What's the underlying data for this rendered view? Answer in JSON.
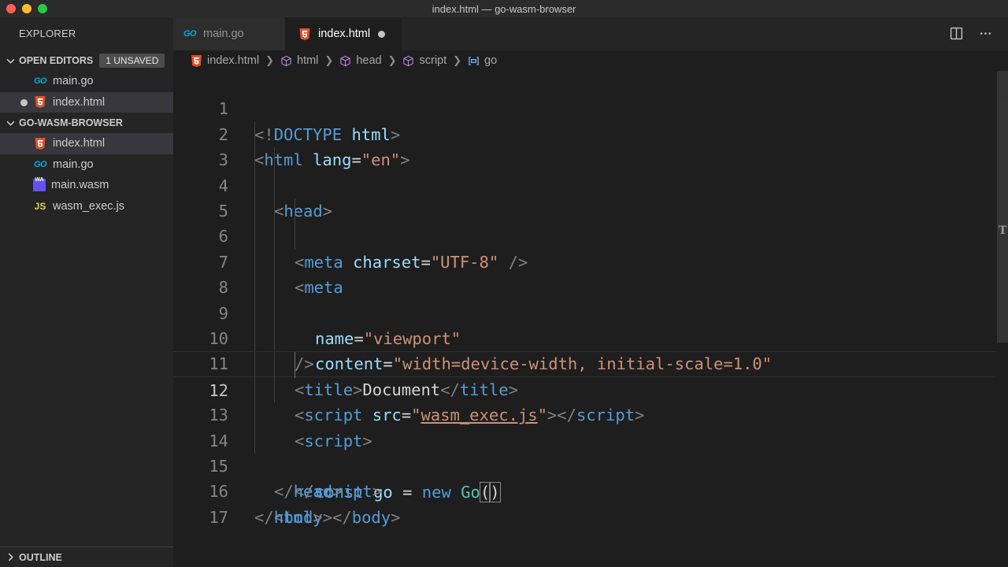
{
  "window": {
    "title": "index.html — go-wasm-browser"
  },
  "sidebar": {
    "title": "EXPLORER",
    "open_editors": {
      "label": "OPEN EDITORS",
      "badge": "1 UNSAVED",
      "items": [
        {
          "name": "main.go",
          "icon": "go-icon",
          "unsaved": false
        },
        {
          "name": "index.html",
          "icon": "html5-icon",
          "unsaved": true
        }
      ]
    },
    "project": {
      "label": "GO-WASM-BROWSER",
      "items": [
        {
          "name": "index.html",
          "icon": "html5-icon",
          "selected": true
        },
        {
          "name": "main.go",
          "icon": "go-icon"
        },
        {
          "name": "main.wasm",
          "icon": "wasm-icon"
        },
        {
          "name": "wasm_exec.js",
          "icon": "js-icon"
        }
      ]
    },
    "outline": {
      "label": "OUTLINE"
    }
  },
  "icons": {
    "go": "GO",
    "js": "JS",
    "wasm": "WA"
  },
  "tabs": [
    {
      "label": "main.go",
      "active": false
    },
    {
      "label": "index.html",
      "active": true,
      "unsaved": true
    }
  ],
  "breadcrumb": [
    "index.html",
    "html",
    "head",
    "script",
    "go"
  ],
  "editor": {
    "line_numbers": [
      "1",
      "2",
      "3",
      "4",
      "5",
      "6",
      "7",
      "8",
      "9",
      "10",
      "11",
      "12",
      "13",
      "14",
      "15",
      "16",
      "17"
    ],
    "current_line": 12,
    "code": {
      "l1": [
        "<!",
        "DOCTYPE",
        " ",
        "html",
        ">"
      ],
      "l2": [
        "<",
        "html",
        " ",
        "lang",
        "=",
        "\"en\"",
        ">"
      ],
      "l3": [
        "<",
        "head",
        ">"
      ],
      "l4": [
        "<",
        "meta",
        " ",
        "charset",
        "=",
        "\"UTF-8\"",
        " ",
        "/>"
      ],
      "l5": [
        "<",
        "meta"
      ],
      "l6": [
        "name",
        "=",
        "\"viewport\""
      ],
      "l7": [
        "content",
        "=",
        "\"width=device-width, initial-scale=1.0\""
      ],
      "l8": [
        "/>"
      ],
      "l9": [
        "<",
        "title",
        ">",
        "Document",
        "</",
        "title",
        ">"
      ],
      "l10": [
        "<",
        "script",
        " ",
        "src",
        "=",
        "\"",
        "wasm_exec.js",
        "\"",
        "></",
        "script",
        ">"
      ],
      "l11": [
        "<",
        "script",
        ">"
      ],
      "l12": [
        "const",
        " ",
        "go",
        " = ",
        "new",
        " ",
        "Go",
        "(",
        ")"
      ],
      "l13": [
        "</",
        "script",
        ">"
      ],
      "l14": [
        "</",
        "head",
        ">"
      ],
      "l15": [
        "<",
        "body",
        "></",
        "body",
        ">"
      ],
      "l16": [
        "</",
        "html",
        ">"
      ]
    }
  },
  "colors": {
    "keyword": "#569cd6",
    "attribute": "#9cdcfe",
    "string": "#ce9178",
    "class": "#4ec9b0",
    "punctuation": "#808080"
  }
}
